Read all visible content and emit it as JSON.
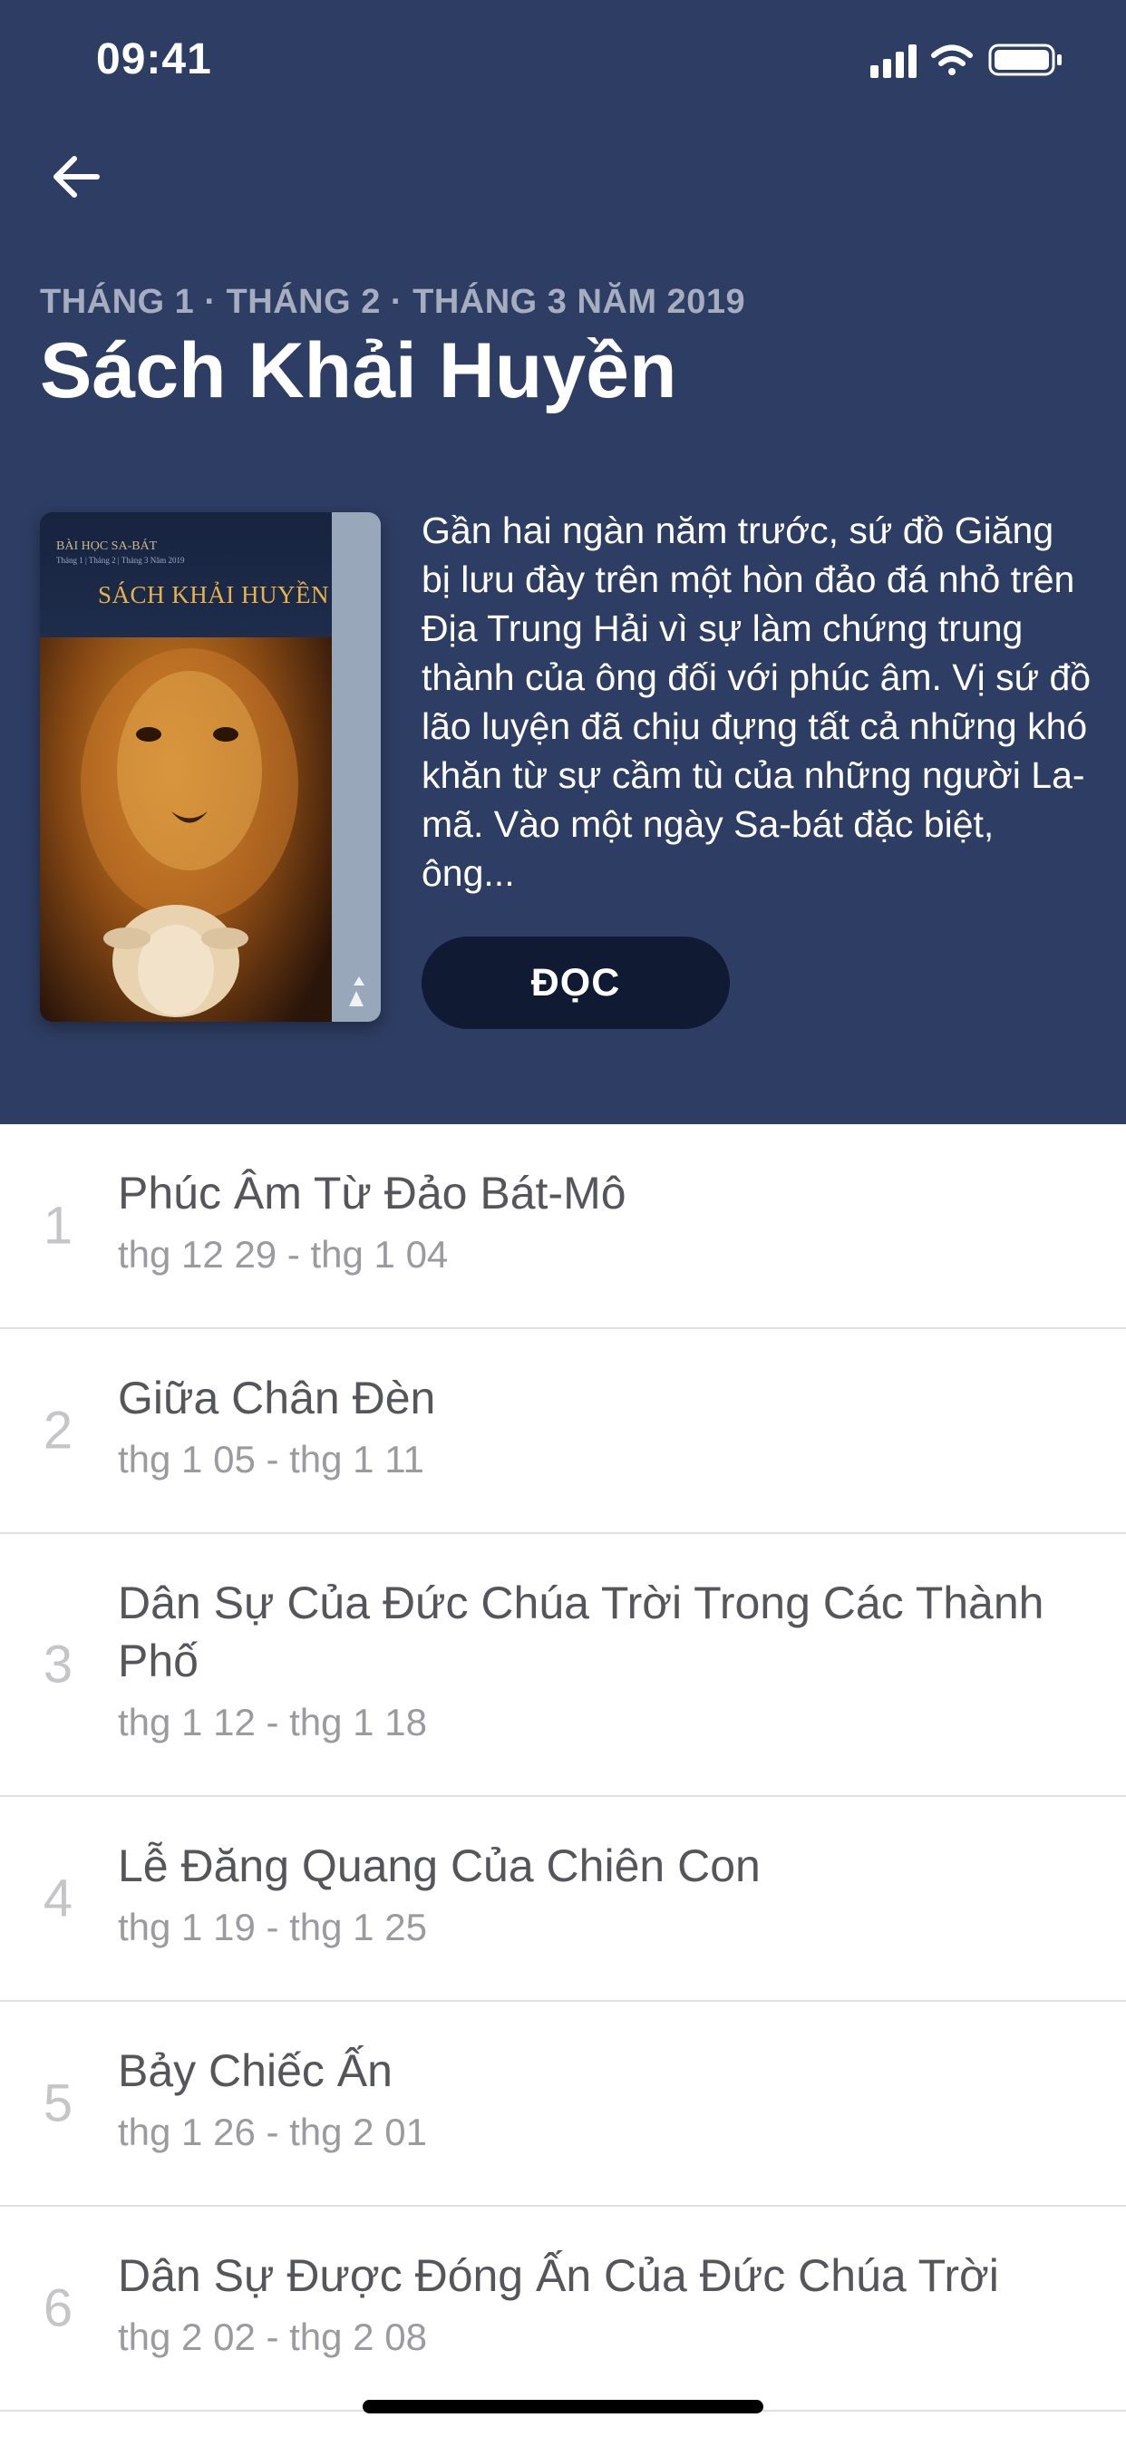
{
  "status_bar": {
    "time": "09:41",
    "icons": [
      "cellular-signal-icon",
      "wifi-icon",
      "battery-icon"
    ]
  },
  "header": {
    "back_icon": "arrow-left-icon",
    "period": "THÁNG 1 · THÁNG 2 · THÁNG 3 NĂM 2019",
    "title": "Sách Khải Huyền",
    "cover": {
      "kicker": "BÀI HỌC SA-BÁT",
      "subtitle": "Tháng 1 | Tháng 2 | Tháng 3 Năm 2019",
      "title": "SÁCH KHẢI HUYỀN"
    },
    "description": "Gần hai ngàn năm trước, sứ đồ Giăng bị lưu đày trên một hòn đảo đá nhỏ trên Địa Trung Hải vì sự làm chứng trung thành của ông đối với phúc âm. Vị sứ đồ lão luyện đã chịu đựng tất cả những khó khăn từ sự cầm tù của những người La- mã. Vào một ngày Sa-bát đặc biệt, ông...",
    "read_label": "ĐỌC"
  },
  "colors": {
    "header_bg": "#2e3d63",
    "button_bg": "#111a33",
    "lesson_title": "#55555c",
    "lesson_date": "#9a9aa0",
    "lesson_number": "#c5c5c9"
  },
  "lessons": [
    {
      "number": "1",
      "title": "Phúc Âm Từ Đảo Bát-Mô",
      "date": "thg 12 29 - thg 1 04"
    },
    {
      "number": "2",
      "title": "Giữa Chân Đèn",
      "date": "thg 1 05 - thg 1 11"
    },
    {
      "number": "3",
      "title": "Dân Sự Của Đức Chúa Trời Trong Các Thành Phố",
      "date": "thg 1 12 - thg 1 18"
    },
    {
      "number": "4",
      "title": "Lễ Đăng Quang Của Chiên Con",
      "date": "thg 1 19 - thg 1 25"
    },
    {
      "number": "5",
      "title": "Bảy Chiếc Ấn",
      "date": "thg 1 26 - thg 2 01"
    },
    {
      "number": "6",
      "title": "Dân Sự Được Đóng Ấn Của Đức Chúa Trời",
      "date": "thg 2 02 - thg 2 08"
    }
  ]
}
